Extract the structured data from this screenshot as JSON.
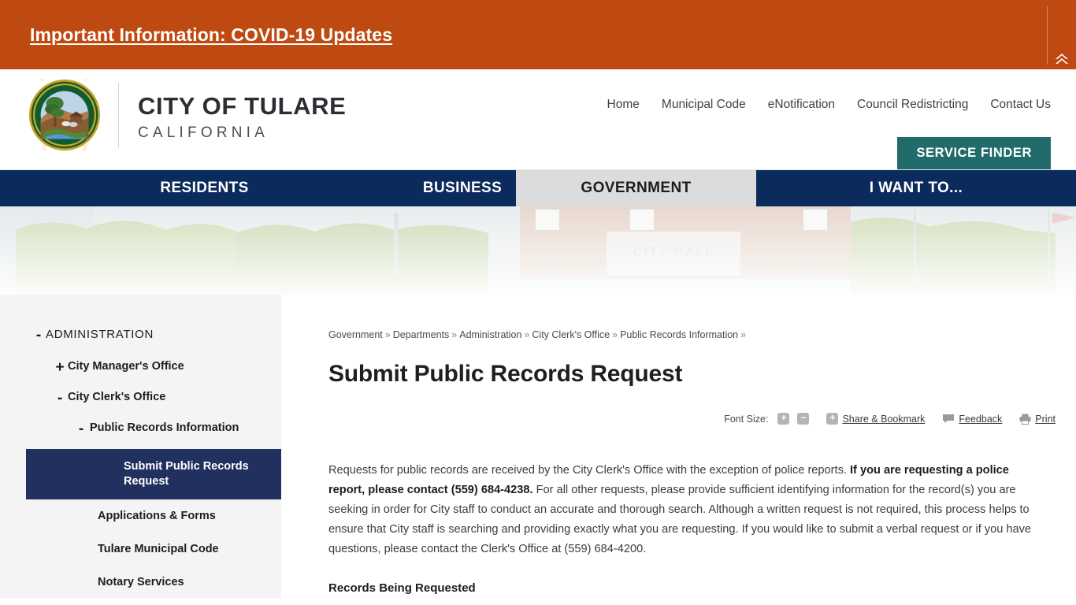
{
  "alert": {
    "text": "Important Information: COVID-19 Updates",
    "bg_color": "#bf4a11",
    "collapse_icon": "double-chevron-up-icon"
  },
  "header": {
    "seal_alt": "City of Tulare seal",
    "seal_top_text": "CITY OF TULARE",
    "seal_bottom_text": "INCORPORATED APRIL 5 1888",
    "brand_name": "CITY OF TULARE",
    "brand_sub": "CALIFORNIA",
    "top_nav": [
      {
        "label": "Home"
      },
      {
        "label": "Municipal Code"
      },
      {
        "label": "eNotification"
      },
      {
        "label": "Council Redistricting"
      },
      {
        "label": "Contact Us"
      }
    ],
    "service_finder_label": "SERVICE FINDER",
    "service_finder_color": "#226b6b"
  },
  "main_nav": {
    "active": "GOVERNMENT",
    "bg_color": "#0b2b5c",
    "active_bg_color": "#dcdcdc",
    "items": [
      {
        "label": "RESIDENTS"
      },
      {
        "label": "BUSINESS"
      },
      {
        "label": "GOVERNMENT"
      },
      {
        "label": "I WANT TO..."
      }
    ]
  },
  "sidebar": {
    "bg_color": "#f4f4f4",
    "selected_bg_color": "#21305e",
    "administration": {
      "toggle": "-",
      "label": "ADMINISTRATION"
    },
    "city_manager": {
      "toggle": "+",
      "label": "City Manager's Office"
    },
    "city_clerk": {
      "toggle": "-",
      "label": "City Clerk's Office"
    },
    "public_records": {
      "toggle": "-",
      "label": "Public Records Information"
    },
    "submit_request": {
      "label": "Submit Public Records Request"
    },
    "leaves": [
      {
        "label": "Applications & Forms"
      },
      {
        "label": "Tulare Municipal Code"
      },
      {
        "label": "Notary Services"
      }
    ]
  },
  "breadcrumb": {
    "items": [
      {
        "label": "Government"
      },
      {
        "label": "Departments"
      },
      {
        "label": "Administration"
      },
      {
        "label": "City Clerk's Office"
      },
      {
        "label": "Public Records Information"
      }
    ],
    "separator": "»"
  },
  "page": {
    "title": "Submit Public Records Request"
  },
  "tools": {
    "font_size_label": "Font Size:",
    "increase_label": "+",
    "decrease_label": "−",
    "share_plus_label": "+",
    "share_label": "Share & Bookmark",
    "feedback_label": "Feedback",
    "print_label": "Print"
  },
  "body": {
    "p1_part1": "Requests for public records are received by the City Clerk's Office with the exception of police reports. ",
    "p1_bold": "If you are requesting a police report, please contact (559) 684-4238.",
    "p1_part2": " For all other requests, please provide sufficient identifying information for the record(s) you are seeking in order for City staff to conduct an accurate and thorough search. Although a written request is not required, this process helps to ensure that City staff is searching and providing exactly what you are requesting. If you would like to submit a verbal request or if you have questions, please contact the Clerk's Office at (559) 684-4200.",
    "records_heading": "Records Being Requested"
  }
}
